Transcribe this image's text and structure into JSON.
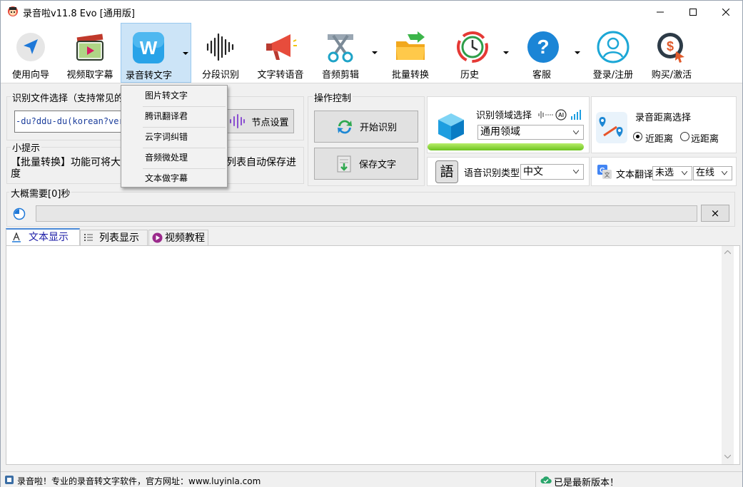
{
  "window": {
    "title": "录音啦v11.8 Evo [通用版]",
    "minimize_icon": "minimize-icon",
    "maximize_icon": "maximize-icon",
    "close_icon": "close-icon"
  },
  "toolbar": {
    "items": [
      {
        "label": "使用向导",
        "icon": "navigation-arrow-icon"
      },
      {
        "label": "视频取字幕",
        "icon": "video-film-icon"
      },
      {
        "label": "录音转文字",
        "icon": "w-logo-icon"
      },
      {
        "label": "分段识别",
        "icon": "waveform-icon"
      },
      {
        "label": "文字转语音",
        "icon": "megaphone-icon"
      },
      {
        "label": "音频剪辑",
        "icon": "scissors-icon"
      },
      {
        "label": "批量转换",
        "icon": "folder-arrow-icon"
      },
      {
        "label": "历史",
        "icon": "history-clock-icon"
      },
      {
        "label": "客服",
        "icon": "help-question-icon"
      },
      {
        "label": "登录/注册",
        "icon": "user-icon"
      },
      {
        "label": "购买/激活",
        "icon": "purchase-coin-icon"
      }
    ]
  },
  "dropdown_menu": {
    "items": [
      "图片转文字",
      "腾讯翻译君",
      "云字词纠错",
      "音频微处理",
      "文本做字幕"
    ]
  },
  "file_select": {
    "title": "识别文件选择（支持常见的音",
    "value": "-du?ddu-du(korean?ver",
    "node_button": "节点设置"
  },
  "tips": {
    "title": "小提示",
    "line1_left": "【批量转换】功能可将大",
    "line1_right": "列表自动保存进",
    "line2": "度"
  },
  "operation": {
    "title": "操作控制",
    "start_button": "开始识别",
    "save_button": "保存文字"
  },
  "domain": {
    "label": "识别领域选择",
    "selected": "通用领域",
    "ai_badge": "AI"
  },
  "distance": {
    "label": "录音距离选择",
    "options": [
      "近距离",
      "远距离"
    ],
    "selected": "近距离"
  },
  "language": {
    "label": "语音识别类型",
    "selected": "中文",
    "icon_char": "語"
  },
  "translate": {
    "label": "文本翻译",
    "option1": "未选",
    "option2": "在线"
  },
  "progress": {
    "label": "大概需要[0]秒",
    "value": 0,
    "clear_button": "×"
  },
  "tabs": [
    "文本显示",
    "列表显示",
    "视频教程"
  ],
  "status": {
    "left": "录音啦！专业的录音转文字软件，官方网址：www.luyinla.com",
    "right": "已是最新版本！"
  },
  "colors": {
    "accent": "#0078d7",
    "active_tool_bg": "#cce4f7",
    "progress_green": "#7fd22a"
  }
}
